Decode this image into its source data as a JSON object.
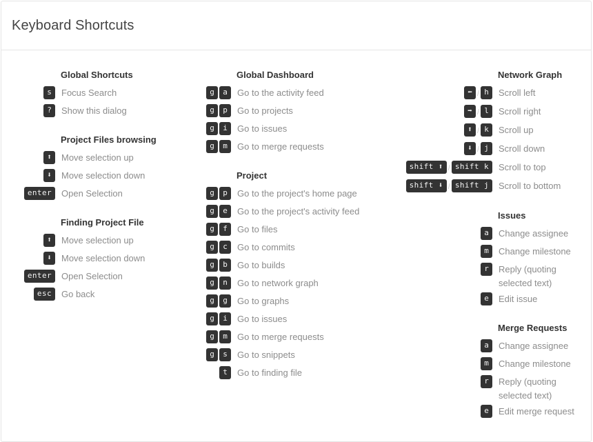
{
  "header": {
    "title": "Keyboard Shortcuts"
  },
  "columns": [
    {
      "id": "column-left",
      "groups": [
        {
          "id": "global-shortcuts",
          "heading": "Global Shortcuts",
          "rows": [
            {
              "keys": [
                {
                  "label": "s"
                }
              ],
              "desc": "Focus Search"
            },
            {
              "keys": [
                {
                  "label": "?"
                }
              ],
              "desc": "Show this dialog"
            }
          ]
        },
        {
          "id": "project-files-browsing",
          "heading": "Project Files browsing",
          "rows": [
            {
              "keys": [
                {
                  "label": "⬆",
                  "icon": "arrow-up-icon"
                }
              ],
              "desc": "Move selection up"
            },
            {
              "keys": [
                {
                  "label": "⬇",
                  "icon": "arrow-down-icon"
                }
              ],
              "desc": "Move selection down"
            },
            {
              "keys": [
                {
                  "label": "enter",
                  "wide": true
                }
              ],
              "desc": "Open Selection"
            }
          ]
        },
        {
          "id": "finding-project-file",
          "heading": "Finding Project File",
          "rows": [
            {
              "keys": [
                {
                  "label": "⬆",
                  "icon": "arrow-up-icon"
                }
              ],
              "desc": "Move selection up"
            },
            {
              "keys": [
                {
                  "label": "⬇",
                  "icon": "arrow-down-icon"
                }
              ],
              "desc": "Move selection down"
            },
            {
              "keys": [
                {
                  "label": "enter",
                  "wide": true
                }
              ],
              "desc": "Open Selection"
            },
            {
              "keys": [
                {
                  "label": "esc",
                  "wide": true
                }
              ],
              "desc": "Go back"
            }
          ]
        }
      ]
    },
    {
      "id": "column-middle",
      "groups": [
        {
          "id": "global-dashboard",
          "heading": "Global Dashboard",
          "rows": [
            {
              "keys": [
                {
                  "label": "g"
                },
                {
                  "label": "a"
                }
              ],
              "desc": "Go to the activity feed"
            },
            {
              "keys": [
                {
                  "label": "g"
                },
                {
                  "label": "p"
                }
              ],
              "desc": "Go to projects"
            },
            {
              "keys": [
                {
                  "label": "g"
                },
                {
                  "label": "i"
                }
              ],
              "desc": "Go to issues"
            },
            {
              "keys": [
                {
                  "label": "g"
                },
                {
                  "label": "m"
                }
              ],
              "desc": "Go to merge requests"
            }
          ]
        },
        {
          "id": "project",
          "heading": "Project",
          "rows": [
            {
              "keys": [
                {
                  "label": "g"
                },
                {
                  "label": "p"
                }
              ],
              "desc": "Go to the project's home page"
            },
            {
              "keys": [
                {
                  "label": "g"
                },
                {
                  "label": "e"
                }
              ],
              "desc": "Go to the project's activity feed"
            },
            {
              "keys": [
                {
                  "label": "g"
                },
                {
                  "label": "f"
                }
              ],
              "desc": "Go to files"
            },
            {
              "keys": [
                {
                  "label": "g"
                },
                {
                  "label": "c"
                }
              ],
              "desc": "Go to commits"
            },
            {
              "keys": [
                {
                  "label": "g"
                },
                {
                  "label": "b"
                }
              ],
              "desc": "Go to builds"
            },
            {
              "keys": [
                {
                  "label": "g"
                },
                {
                  "label": "n"
                }
              ],
              "desc": "Go to network graph"
            },
            {
              "keys": [
                {
                  "label": "g"
                },
                {
                  "label": "g"
                }
              ],
              "desc": "Go to graphs"
            },
            {
              "keys": [
                {
                  "label": "g"
                },
                {
                  "label": "i"
                }
              ],
              "desc": "Go to issues"
            },
            {
              "keys": [
                {
                  "label": "g"
                },
                {
                  "label": "m"
                }
              ],
              "desc": "Go to merge requests"
            },
            {
              "keys": [
                {
                  "label": "g"
                },
                {
                  "label": "s"
                }
              ],
              "desc": "Go to snippets"
            },
            {
              "keys": [
                {
                  "label": "t"
                }
              ],
              "desc": "Go to finding file"
            }
          ]
        }
      ]
    },
    {
      "id": "column-right",
      "groups": [
        {
          "id": "network-graph",
          "heading": "Network Graph",
          "rows": [
            {
              "keys": [
                {
                  "label": "⬅",
                  "icon": "arrow-left-icon"
                },
                {
                  "sep": "/"
                },
                {
                  "label": "h"
                }
              ],
              "desc": "Scroll left"
            },
            {
              "keys": [
                {
                  "label": "➡",
                  "icon": "arrow-right-icon"
                },
                {
                  "sep": "/"
                },
                {
                  "label": "l"
                }
              ],
              "desc": "Scroll right"
            },
            {
              "keys": [
                {
                  "label": "⬆",
                  "icon": "arrow-up-icon"
                },
                {
                  "sep": "/"
                },
                {
                  "label": "k"
                }
              ],
              "desc": "Scroll up"
            },
            {
              "keys": [
                {
                  "label": "⬇",
                  "icon": "arrow-down-icon"
                },
                {
                  "sep": "/"
                },
                {
                  "label": "j"
                }
              ],
              "desc": "Scroll down"
            },
            {
              "keys": [
                {
                  "label": "shift ⬆",
                  "wide": true,
                  "icon": "shift-arrow-up-icon"
                },
                {
                  "sep": "/"
                },
                {
                  "label": "shift k",
                  "wide": true
                }
              ],
              "desc": "Scroll to top"
            },
            {
              "keys": [
                {
                  "label": "shift ⬇",
                  "wide": true,
                  "icon": "shift-arrow-down-icon"
                },
                {
                  "sep": "/"
                },
                {
                  "label": "shift j",
                  "wide": true
                }
              ],
              "desc": "Scroll to bottom"
            }
          ]
        },
        {
          "id": "issues",
          "heading": "Issues",
          "rows": [
            {
              "keys": [
                {
                  "label": "a"
                }
              ],
              "desc": "Change assignee"
            },
            {
              "keys": [
                {
                  "label": "m"
                }
              ],
              "desc": "Change milestone"
            },
            {
              "keys": [
                {
                  "label": "r"
                }
              ],
              "desc": "Reply (quoting selected text)",
              "wrap": true
            },
            {
              "keys": [
                {
                  "label": "e"
                }
              ],
              "desc": "Edit issue"
            }
          ]
        },
        {
          "id": "merge-requests",
          "heading": "Merge Requests",
          "rows": [
            {
              "keys": [
                {
                  "label": "a"
                }
              ],
              "desc": "Change assignee"
            },
            {
              "keys": [
                {
                  "label": "m"
                }
              ],
              "desc": "Change milestone"
            },
            {
              "keys": [
                {
                  "label": "r"
                }
              ],
              "desc": "Reply (quoting selected text)",
              "wrap": true
            },
            {
              "keys": [
                {
                  "label": "e"
                }
              ],
              "desc": "Edit merge request"
            }
          ]
        }
      ]
    }
  ],
  "colors": {
    "keycap_bg": "#333333",
    "keycap_text": "#f5f5f5",
    "heading_text": "#333333",
    "desc_text": "#8c8c8c",
    "title_text": "#444444",
    "border": "#e5e5e5"
  }
}
